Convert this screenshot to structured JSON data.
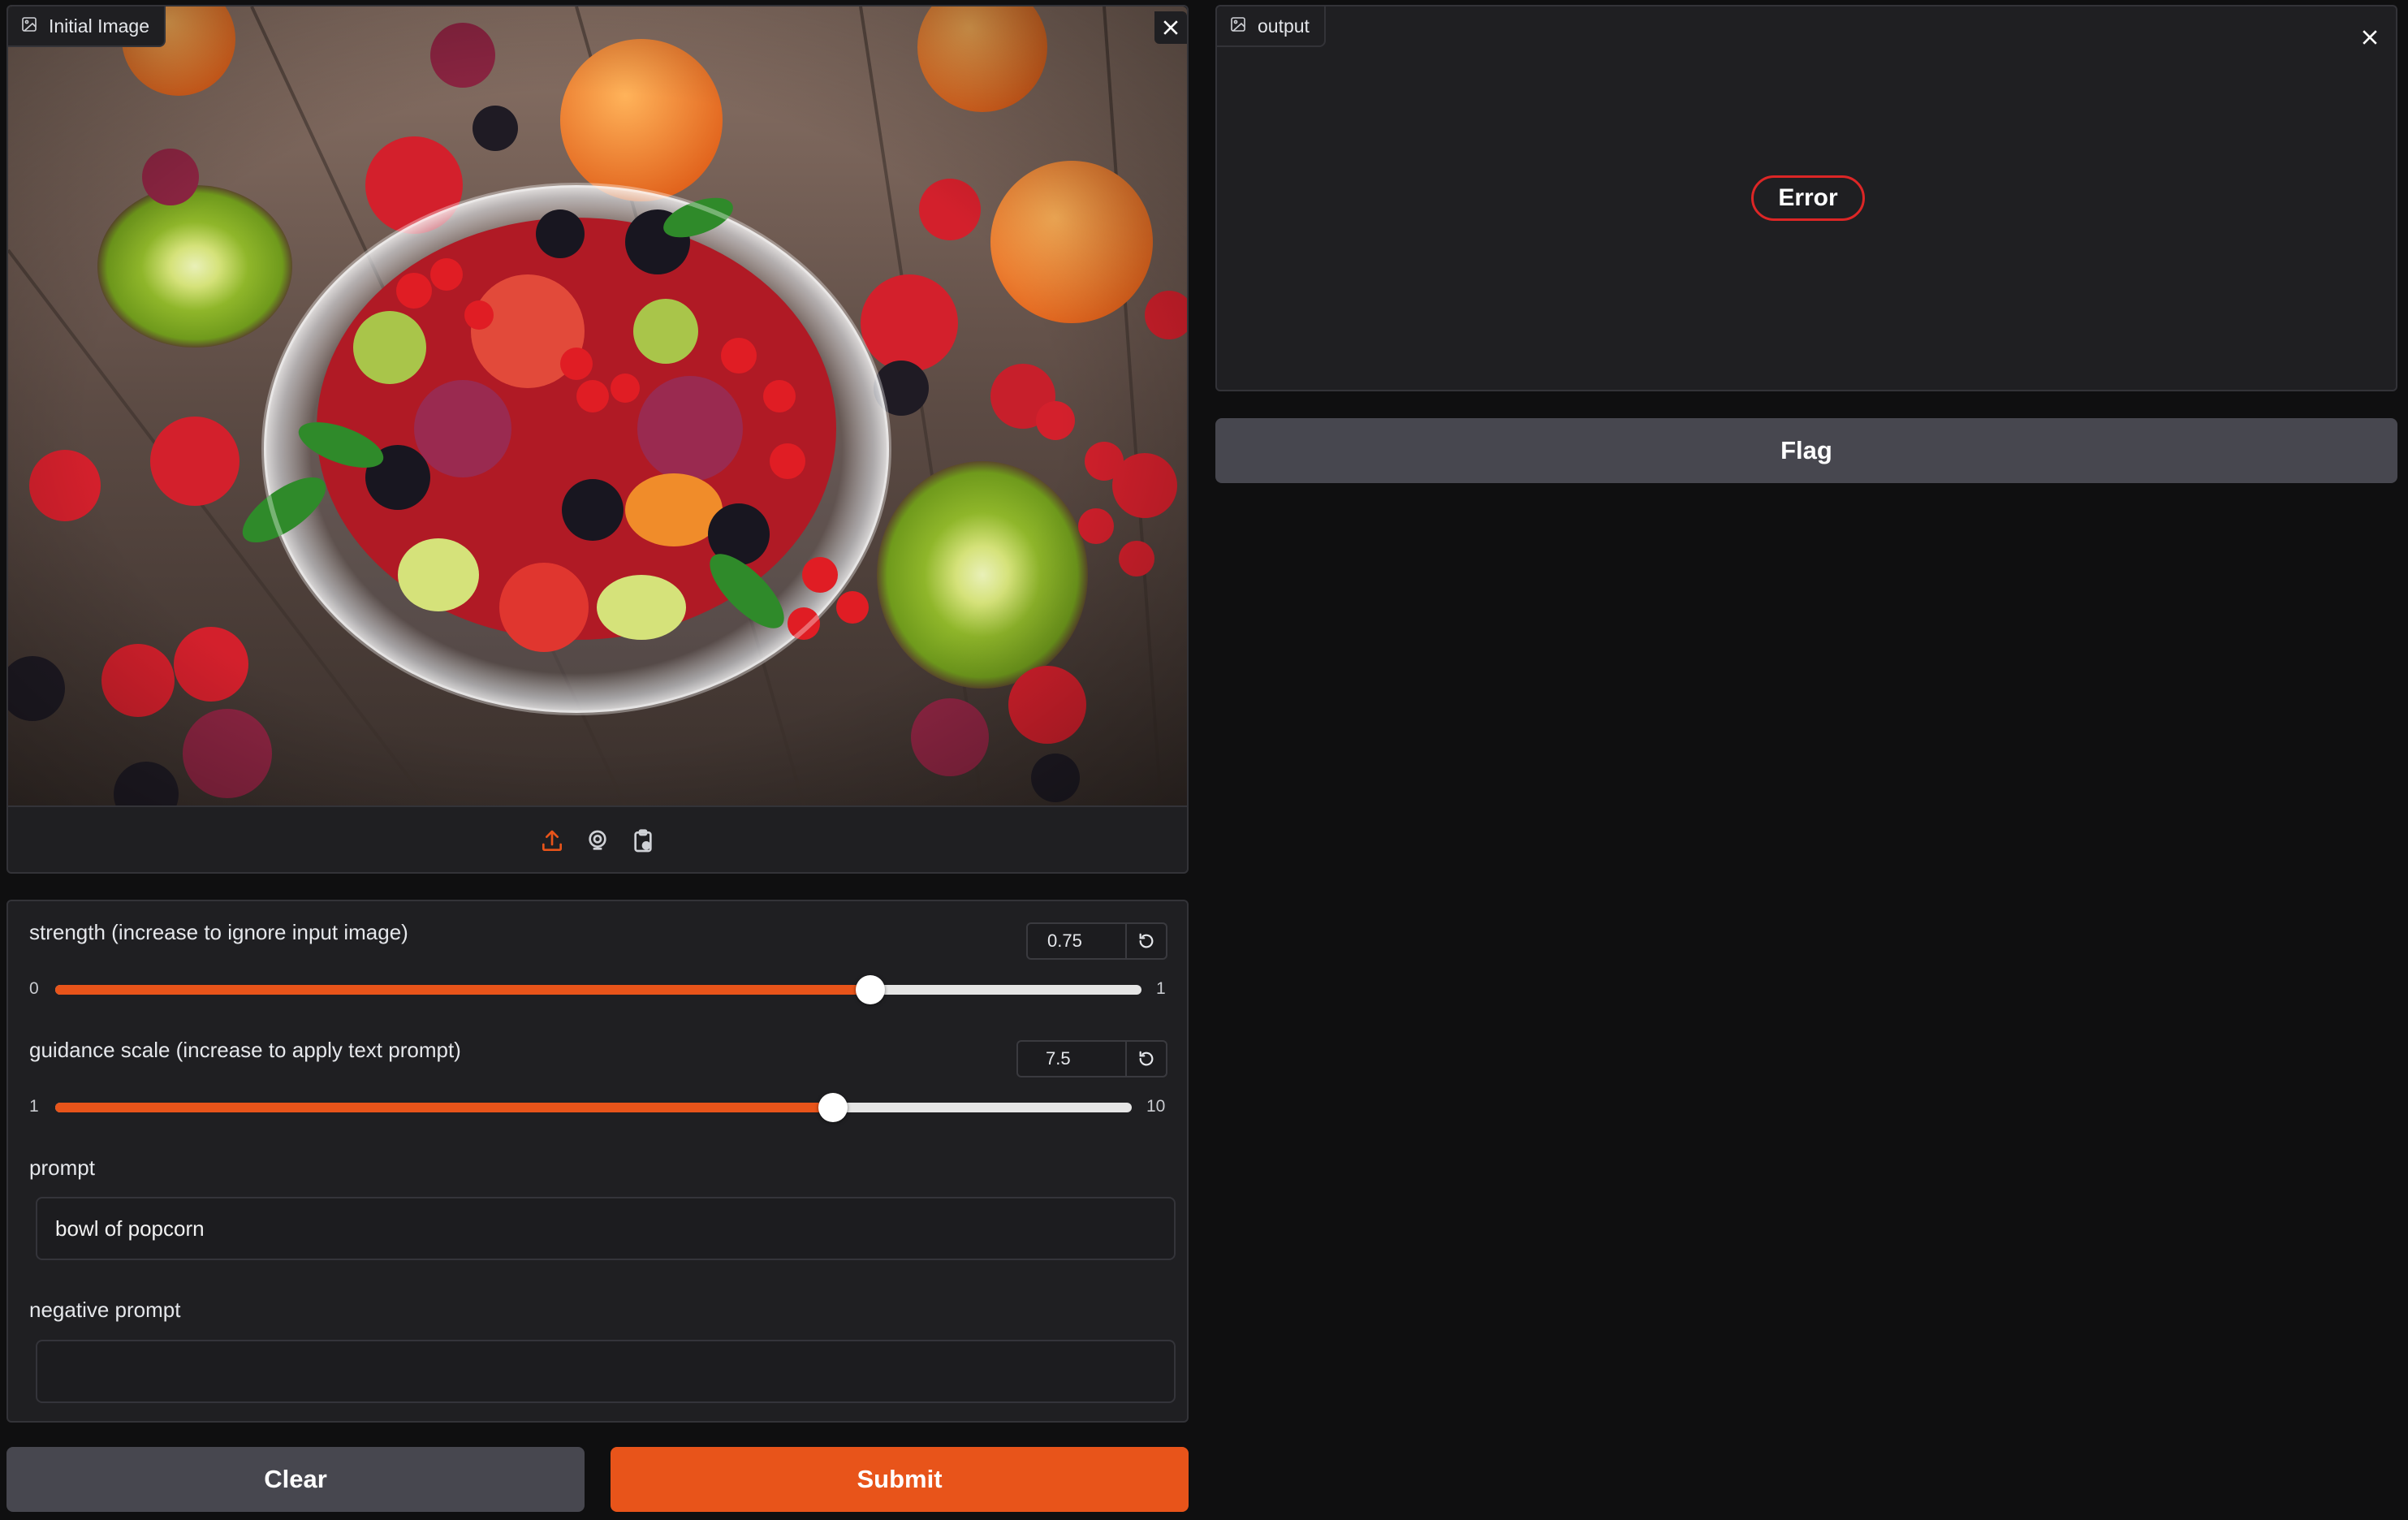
{
  "input_image": {
    "label": "Initial Image",
    "toolbar": [
      "upload-icon",
      "webcam-icon",
      "clipboard-icon"
    ]
  },
  "controls": {
    "strength": {
      "label": "strength (increase to ignore input image)",
      "value": "0.75",
      "min": "0",
      "max": "1",
      "fraction": 0.75
    },
    "guidance": {
      "label": "guidance scale (increase to apply text prompt)",
      "value": "7.5",
      "min": "1",
      "max": "10",
      "fraction": 0.7222
    },
    "prompt": {
      "label": "prompt",
      "value": "bowl of popcorn"
    },
    "negative_prompt": {
      "label": "negative prompt",
      "value": ""
    }
  },
  "buttons": {
    "clear": "Clear",
    "submit": "Submit",
    "flag": "Flag"
  },
  "output": {
    "label": "output",
    "status": "Error"
  },
  "colors": {
    "accent": "#e8541a",
    "error": "#dc2626",
    "panel": "#1f1f22",
    "background": "#0f0f10"
  }
}
